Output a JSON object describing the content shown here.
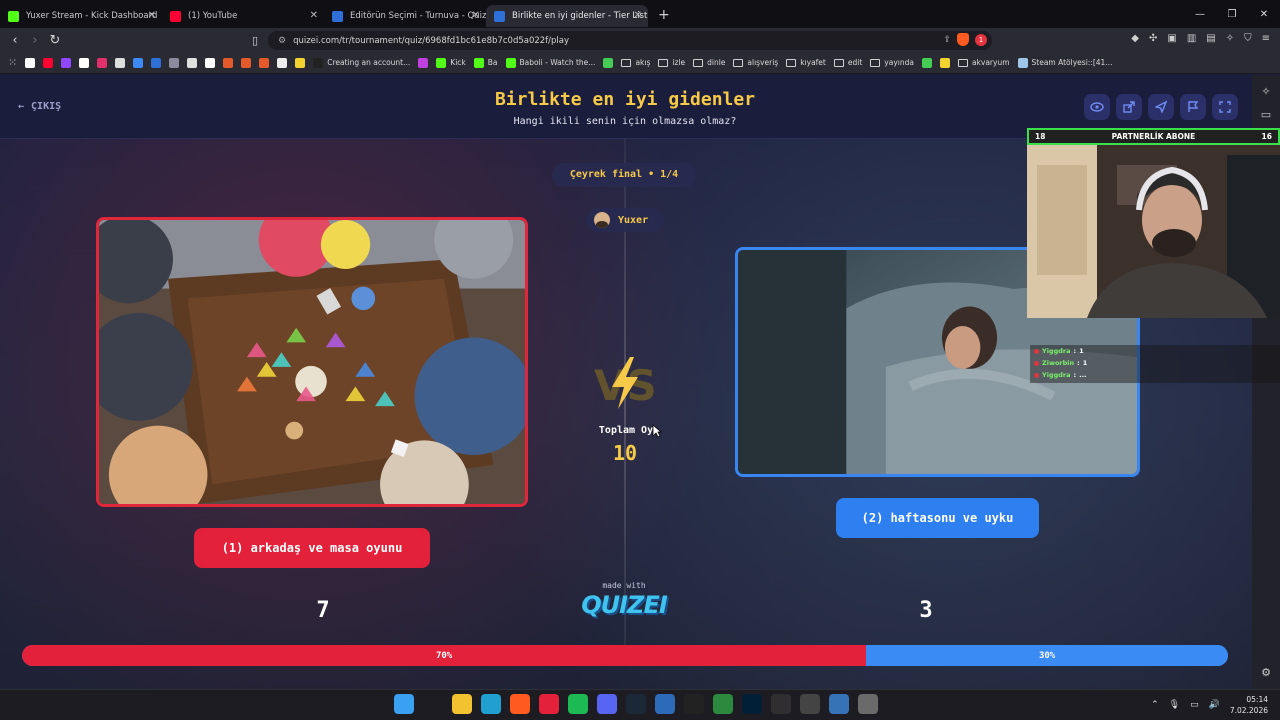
{
  "browser": {
    "tabs": [
      {
        "label": "Yuxer Stream - Kick Dashboard",
        "color": "#53fc18"
      },
      {
        "label": "(1) YouTube",
        "color": "#ff0033"
      },
      {
        "label": "Editörün Seçimi - Turnuva - Quizei",
        "color": "#2f6fd8"
      },
      {
        "label": "Birlikte en iyi gidenler - Tier List",
        "color": "#2f6fd8",
        "active": true
      }
    ],
    "new_tab": "+",
    "url": "quizei.com/tr/tournament/quiz/6968fd1bc61e8b7c0d5a022f/play",
    "alert_count": "1",
    "bookmarks": [
      {
        "label": "",
        "icon": "google",
        "color": "#ffffff"
      },
      {
        "label": "",
        "icon": "youtube",
        "color": "#ff0033"
      },
      {
        "label": "",
        "icon": "twitch",
        "color": "#9146ff"
      },
      {
        "label": "",
        "icon": "x",
        "color": "#ffffff"
      },
      {
        "label": "",
        "icon": "instagram",
        "color": "#e1306c"
      },
      {
        "label": "",
        "icon": "github",
        "color": "#dddddd"
      },
      {
        "label": "",
        "icon": "app",
        "color": "#3d8af7"
      },
      {
        "label": "",
        "icon": "app",
        "color": "#2f6fd8"
      },
      {
        "label": "",
        "icon": "app",
        "color": "#8a8aa0"
      },
      {
        "label": "",
        "icon": "app",
        "color": "#e0e0e0"
      },
      {
        "label": "",
        "icon": "app",
        "color": "#ffffff"
      },
      {
        "label": "",
        "icon": "app",
        "color": "#e55a2b"
      },
      {
        "label": "",
        "icon": "app",
        "color": "#e55a2b"
      },
      {
        "label": "",
        "icon": "app",
        "color": "#e55a2b"
      },
      {
        "label": "",
        "icon": "app",
        "color": "#eeeeee"
      },
      {
        "label": "",
        "icon": "app",
        "color": "#f2d330"
      },
      {
        "label": "Creating an account...",
        "icon": "app",
        "color": "#222222"
      },
      {
        "label": "",
        "icon": "app",
        "color": "#c040e0"
      },
      {
        "label": "Kick",
        "icon": "kick",
        "color": "#53fc18"
      },
      {
        "label": "Ba",
        "icon": "kick",
        "color": "#53fc18"
      },
      {
        "label": "Baboli - Watch the...",
        "icon": "kick",
        "color": "#53fc18"
      },
      {
        "label": "",
        "icon": "app",
        "color": "#44cc55"
      },
      {
        "label": "akış",
        "icon": "folder",
        "color": "#cfcfcf"
      },
      {
        "label": "izle",
        "icon": "folder",
        "color": "#cfcfcf"
      },
      {
        "label": "dinle",
        "icon": "folder",
        "color": "#cfcfcf"
      },
      {
        "label": "alışveriş",
        "icon": "folder",
        "color": "#cfcfcf"
      },
      {
        "label": "kıyafet",
        "icon": "folder",
        "color": "#cfcfcf"
      },
      {
        "label": "edit",
        "icon": "folder",
        "color": "#cfcfcf"
      },
      {
        "label": "yayında",
        "icon": "folder",
        "color": "#cfcfcf"
      },
      {
        "label": "",
        "icon": "app",
        "color": "#44cc55"
      },
      {
        "label": "",
        "icon": "app",
        "color": "#f2d330"
      },
      {
        "label": "akvaryum",
        "icon": "folder",
        "color": "#cfcfcf"
      },
      {
        "label": "Steam Atölyesi::[41...",
        "icon": "steam",
        "color": "#9ec6e8"
      }
    ]
  },
  "page": {
    "exit_label": "ÇIKIŞ",
    "title": "Birlikte en iyi gidenler",
    "subtitle": "Hangi ikili senin için olmazsa olmaz?",
    "round_label": "Çeyrek final • 1/4",
    "username": "Yuxer",
    "total_label": "Toplam Oy",
    "total_value": "10",
    "made_with": "made with",
    "brand": "QUIZEI"
  },
  "options": [
    {
      "label": "(1) arkadaş ve masa oyunu",
      "votes": "7",
      "percent": 70,
      "percent_label": "70%",
      "color": "#e3213a"
    },
    {
      "label": "(2) haftasonu ve uyku",
      "votes": "3",
      "percent": 30,
      "percent_label": "30%",
      "color": "#2e7ff0"
    }
  ],
  "stream_overlay": {
    "header_left": "18",
    "header_label": "PARTNERLİK ABONE",
    "header_right": "16",
    "chat": [
      {
        "user": "Yiggdra",
        "text": "1"
      },
      {
        "user": "Ziworbin",
        "text": "1"
      },
      {
        "user": "Yiggdra",
        "text": "..."
      }
    ]
  },
  "taskbar": {
    "time": "05:14",
    "date": "7.02.2026",
    "apps": [
      {
        "name": "windows",
        "color": "#3aa0f0"
      },
      {
        "name": "search",
        "color": "#1c1c22"
      },
      {
        "name": "explorer",
        "color": "#f2c230"
      },
      {
        "name": "edge",
        "color": "#1fa0d0"
      },
      {
        "name": "brave",
        "color": "#ff5a1f"
      },
      {
        "name": "opera",
        "color": "#e3213a"
      },
      {
        "name": "spotify",
        "color": "#1db954"
      },
      {
        "name": "discord",
        "color": "#5865f2"
      },
      {
        "name": "steam",
        "color": "#1b2838"
      },
      {
        "name": "notepad",
        "color": "#2d6ab8"
      },
      {
        "name": "capcut",
        "color": "#222222"
      },
      {
        "name": "app-green",
        "color": "#2b8a3e"
      },
      {
        "name": "photoshop",
        "color": "#001e36"
      },
      {
        "name": "obs",
        "color": "#302e31"
      },
      {
        "name": "app-white",
        "color": "#444444"
      },
      {
        "name": "app-blue",
        "color": "#3672b6"
      },
      {
        "name": "settings",
        "color": "#6a6a6a"
      }
    ]
  }
}
